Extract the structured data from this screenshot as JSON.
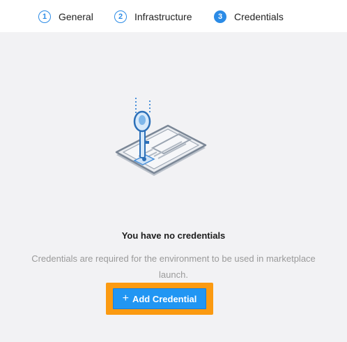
{
  "stepper": {
    "steps": [
      {
        "num": "1",
        "label": "General"
      },
      {
        "num": "2",
        "label": "Infrastructure"
      },
      {
        "num": "3",
        "label": "Credentials",
        "active": true
      }
    ]
  },
  "empty_state": {
    "illustration_icon": "key-document-icon",
    "title": "You have no credentials",
    "description": "Credentials are required for the environment to be used in marketplace launch.",
    "add_button": {
      "icon": "plus-icon",
      "label": "Add Credential"
    }
  },
  "colors": {
    "accent": "#2196f3",
    "highlight": "#fb9a11",
    "background": "#f2f2f4"
  }
}
